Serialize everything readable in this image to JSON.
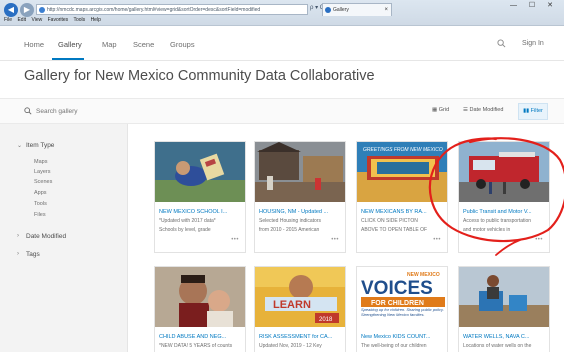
{
  "browser": {
    "address": "http://nmcdc.maps.arcgis.com/home/gallery.html#view=grid&sortOrder=desc&sortField=modified",
    "address_tools": "ρ ▾ C",
    "tab_title": "Gallery",
    "window_controls": "— ☐ ✕",
    "menu": [
      "File",
      "Edit",
      "View",
      "Favorites",
      "Tools",
      "Help"
    ]
  },
  "nav": {
    "items": [
      "Home",
      "Gallery",
      "Map",
      "Scene",
      "Groups"
    ],
    "active": "Gallery",
    "signin": "Sign In"
  },
  "page_title": "Gallery for New Mexico Community Data Collaborative",
  "search": {
    "placeholder": "Search gallery",
    "grid_label": "Grid",
    "sort_label": "Date Modified",
    "filter_label": "Filter"
  },
  "sidebar": {
    "item_type": "Item Type",
    "types": [
      "Maps",
      "Layers",
      "Scenes",
      "Apps",
      "Tools",
      "Files"
    ],
    "date_modified": "Date Modified",
    "tags": "Tags"
  },
  "cards": [
    {
      "title": "NEW MEXICO SCHOOL I...",
      "snippet": "*Updated with 2017 data*",
      "snippet2": "Schools by level, grade"
    },
    {
      "title": "HOUSING, NM - Updated ...",
      "snippet": "Selected Housing indicators",
      "snippet2": "from 2010 - 2015 American"
    },
    {
      "title": "NEW MEXICANS BY RA...",
      "snippet": "CLICK ON SIDE PICTON",
      "snippet2": "ABOVE TO OPEN TABLE OF"
    },
    {
      "title": "Public Transit and Motor V...",
      "snippet": "Access to public transportation",
      "snippet2": "and motor vehicles in"
    },
    {
      "title": "CHILD ABUSE AND NEG...",
      "snippet": "*NEW DATA! 5 YEARS of counts"
    },
    {
      "title": "RISK ASSESSMENT for CA...",
      "snippet": "Updated Nov, 2019 - 12 Key"
    },
    {
      "title": "New Mexico KIDS COUNT...",
      "snippet": "The well-being of our children"
    },
    {
      "title": "WATER WELLS, NAVA C...",
      "snippet": "Locations of water wells on the"
    }
  ],
  "thumb_text": {
    "greetings": "GREETINGS FROM NEW MEXICO",
    "new_mexico_small": "NEW MEXICO",
    "voices": "VOICES",
    "for_children": "FOR CHILDREN",
    "voices_tagline": "Speaking up for children. Sharing public policy. Strengthening New Mexico families.",
    "learn": "LEARN",
    "year": "2018"
  },
  "colors": {
    "accent": "#0079c1",
    "annotation": "#e3201b"
  }
}
